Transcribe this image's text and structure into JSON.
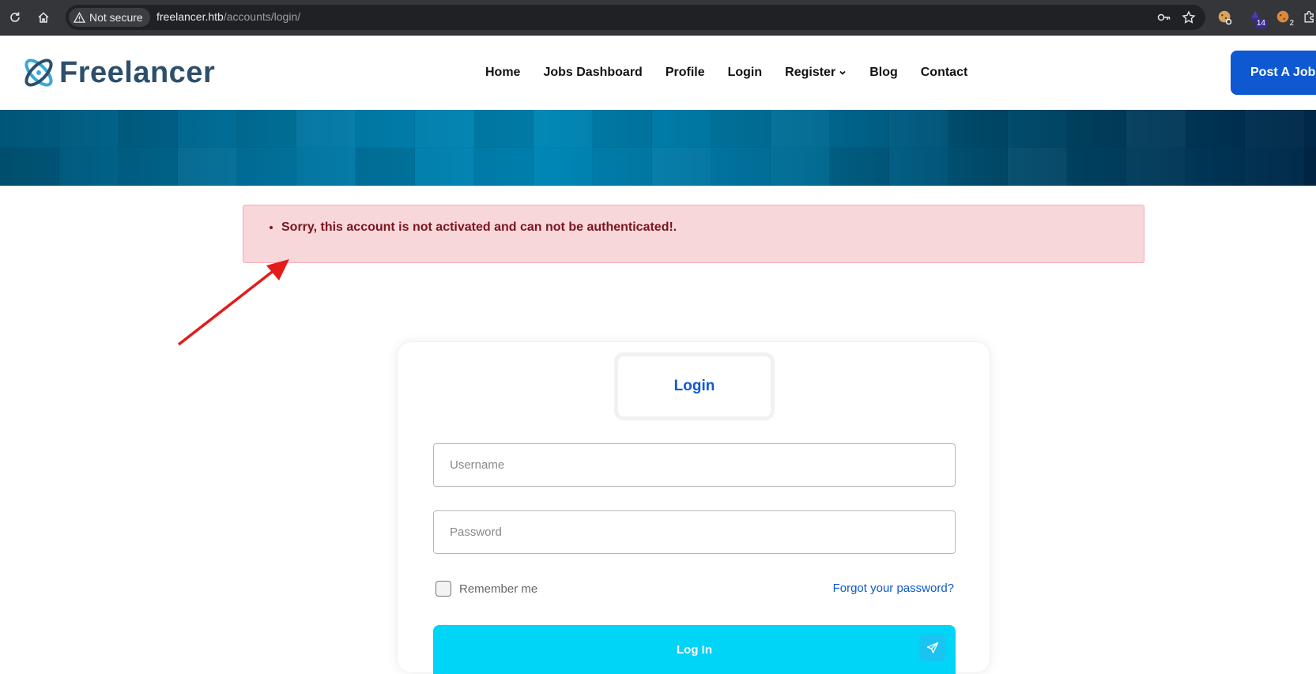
{
  "browser": {
    "security_label": "Not secure",
    "url_host": "freelancer.htb",
    "url_path": "/accounts/login/",
    "extensions": [
      {
        "name": "cookie-extension-icon",
        "badge": ""
      },
      {
        "name": "wizard-extension-icon",
        "badge": "14"
      },
      {
        "name": "cookie-editor-extension-icon",
        "badge": "2"
      }
    ]
  },
  "site": {
    "brand": "Freelancer",
    "nav": [
      {
        "label": "Home"
      },
      {
        "label": "Jobs Dashboard"
      },
      {
        "label": "Profile"
      },
      {
        "label": "Login"
      },
      {
        "label": "Register",
        "has_dropdown": true
      },
      {
        "label": "Blog"
      },
      {
        "label": "Contact"
      }
    ],
    "cta": "Post A Job"
  },
  "alert": {
    "messages": [
      "Sorry, this account is not activated and can not be authenticated!."
    ],
    "color": "#7a1520"
  },
  "login": {
    "tab_label": "Login",
    "username": {
      "placeholder": "Username",
      "value": ""
    },
    "password": {
      "placeholder": "Password",
      "value": ""
    },
    "remember_label": "Remember me",
    "forgot_label": "Forgot your password?",
    "submit_label": "Log In"
  },
  "colors": {
    "primary": "#0e58d2",
    "submit": "#00d4f7",
    "annotation": "#e31b1b"
  }
}
